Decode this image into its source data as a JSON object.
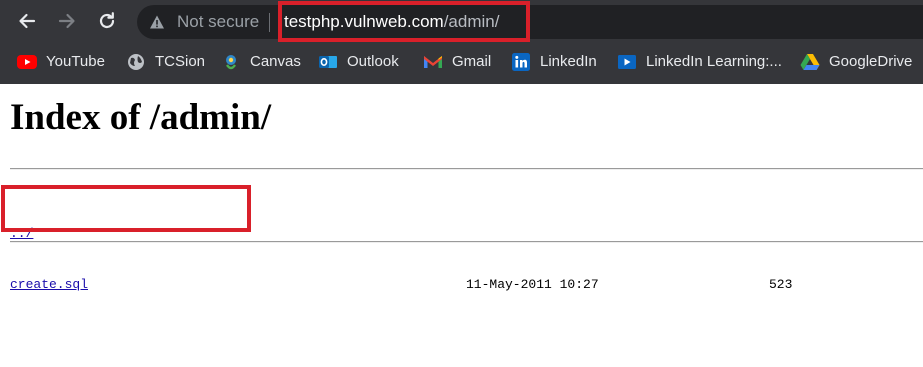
{
  "browser": {
    "security_label": "Not secure",
    "url_host": "testphp.vulnweb.com",
    "url_path": "/admin/",
    "annotation_color": "#d9202a"
  },
  "bookmarks": [
    {
      "label": "YouTube",
      "icon": "youtube-icon"
    },
    {
      "label": "TCSion",
      "icon": "globe-icon"
    },
    {
      "label": "Canvas",
      "icon": "canvas-icon"
    },
    {
      "label": "Outlook",
      "icon": "outlook-icon"
    },
    {
      "label": "Gmail",
      "icon": "gmail-icon"
    },
    {
      "label": "LinkedIn",
      "icon": "linkedin-icon"
    },
    {
      "label": "LinkedIn Learning:...",
      "icon": "linkedin-learning-icon"
    },
    {
      "label": "GoogleDrive",
      "icon": "google-drive-icon"
    }
  ],
  "page": {
    "title": "Index of /admin/",
    "entries": [
      {
        "name": "../",
        "date": "",
        "size": ""
      },
      {
        "name": "create.sql",
        "date": "11-May-2011 10:27",
        "size": "523"
      }
    ]
  }
}
